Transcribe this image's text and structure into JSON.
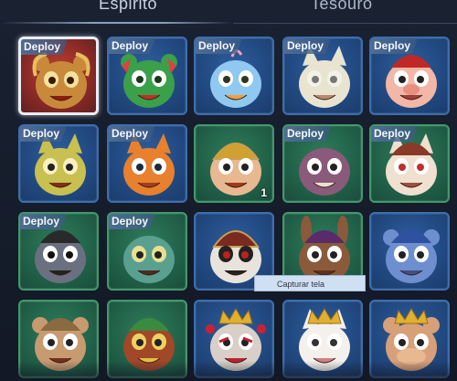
{
  "tabs": [
    {
      "label": "Espirito",
      "active": true
    },
    {
      "label": "Tesouro",
      "active": false
    }
  ],
  "deploy_label": "Deploy",
  "tooltip": "Capturar tela",
  "cards": [
    {
      "name": "lion-dance",
      "deploy": true,
      "selected": true,
      "bg": "red",
      "count": ""
    },
    {
      "name": "green-frog-dragon",
      "deploy": true,
      "bg": "blue",
      "count": ""
    },
    {
      "name": "blue-bird",
      "deploy": true,
      "bg": "blue",
      "count": ""
    },
    {
      "name": "white-fox",
      "deploy": true,
      "bg": "blue",
      "count": ""
    },
    {
      "name": "pig-chef",
      "deploy": true,
      "bg": "blue",
      "count": ""
    },
    {
      "name": "yellow-lizard",
      "deploy": true,
      "bg": "blue",
      "count": ""
    },
    {
      "name": "orange-fox",
      "deploy": true,
      "bg": "blue",
      "count": ""
    },
    {
      "name": "monkey-king",
      "deploy": false,
      "bg": "green",
      "count": "1"
    },
    {
      "name": "purple-bird",
      "deploy": true,
      "bg": "green",
      "count": ""
    },
    {
      "name": "hooded-cat",
      "deploy": true,
      "bg": "green",
      "count": ""
    },
    {
      "name": "opera-mask-face",
      "deploy": true,
      "bg": "green",
      "count": ""
    },
    {
      "name": "teal-frog",
      "deploy": true,
      "bg": "green",
      "count": ""
    },
    {
      "name": "skull-general",
      "deploy": false,
      "bg": "blue",
      "count": ""
    },
    {
      "name": "dog-official",
      "deploy": false,
      "bg": "green",
      "count": ""
    },
    {
      "name": "blue-ox",
      "deploy": false,
      "bg": "blue",
      "count": ""
    },
    {
      "name": "pug-warrior",
      "deploy": false,
      "bg": "green",
      "count": ""
    },
    {
      "name": "owl-monk",
      "deploy": false,
      "bg": "green",
      "count": ""
    },
    {
      "name": "peking-opera-mask",
      "deploy": false,
      "bg": "blue",
      "count": ""
    },
    {
      "name": "crowned-cat",
      "deploy": false,
      "bg": "blue",
      "count": ""
    },
    {
      "name": "fancy-hippo",
      "deploy": false,
      "bg": "blue",
      "count": ""
    }
  ]
}
